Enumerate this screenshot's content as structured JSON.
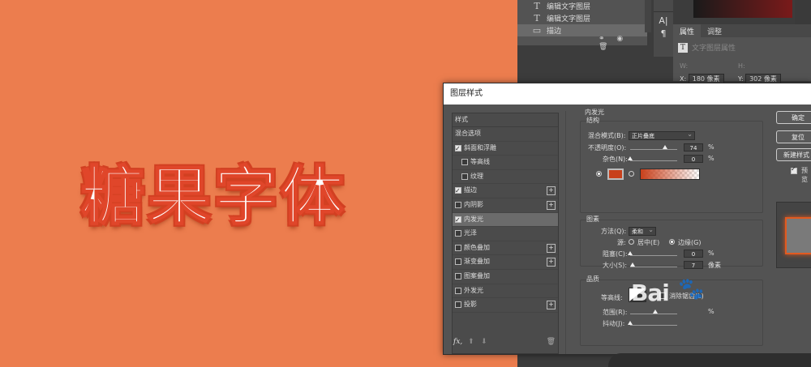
{
  "canvas": {
    "headline": "糖果字体"
  },
  "layers_panel": {
    "rows": [
      {
        "icon": "T",
        "label": "编辑文字图层"
      },
      {
        "icon": "T",
        "label": "编辑文字图层"
      },
      {
        "icon": "▭",
        "label": "描边"
      }
    ],
    "bottom_icons": "⚭ ◉ 🗑"
  },
  "tools": {
    "items": [
      "A|",
      "¶"
    ]
  },
  "properties": {
    "tab_properties": "属性",
    "tab_adjust": "调整",
    "header": "文字图层属性",
    "w_label": "W:",
    "h_label": "H:",
    "x_label": "X:",
    "x_value": "180 像素",
    "y_label": "Y:",
    "y_value": "302 像素"
  },
  "dialog": {
    "title": "图层样式",
    "style_list": {
      "header": "样式",
      "blend_options": "混合选项",
      "items": [
        {
          "label": "斜面和浮雕",
          "checked": true,
          "sub": false,
          "plus": false
        },
        {
          "label": "等高线",
          "checked": false,
          "sub": true,
          "plus": false
        },
        {
          "label": "纹理",
          "checked": false,
          "sub": true,
          "plus": false
        },
        {
          "label": "描边",
          "checked": true,
          "sub": false,
          "plus": true
        },
        {
          "label": "内阴影",
          "checked": false,
          "sub": false,
          "plus": true
        },
        {
          "label": "内发光",
          "checked": true,
          "sub": false,
          "plus": false,
          "selected": true
        },
        {
          "label": "光泽",
          "checked": false,
          "sub": false,
          "plus": false
        },
        {
          "label": "颜色叠加",
          "checked": false,
          "sub": false,
          "plus": true
        },
        {
          "label": "渐变叠加",
          "checked": false,
          "sub": false,
          "plus": true
        },
        {
          "label": "图案叠加",
          "checked": false,
          "sub": false,
          "plus": false
        },
        {
          "label": "外发光",
          "checked": false,
          "sub": false,
          "plus": false
        },
        {
          "label": "投影",
          "checked": false,
          "sub": false,
          "plus": true
        }
      ],
      "fx": "fx,",
      "up": "⬆",
      "down": "⬇",
      "trash": "🗑"
    },
    "inner_glow": {
      "title": "内发光",
      "structure": {
        "title": "结构",
        "blend_mode_label": "混合模式(B):",
        "blend_mode_value": "正片叠底",
        "opacity_label": "不透明度(O):",
        "opacity_value": "74",
        "opacity": 0.74,
        "noise_label": "杂色(N):",
        "noise_value": "0",
        "percent": "%",
        "glow_color": "#c8401b"
      },
      "elements": {
        "title": "图素",
        "method_label": "方法(Q):",
        "method_value": "柔和",
        "source_label": "源:",
        "source_center": "居中(E)",
        "source_edge": "边缘(G)",
        "choke_label": "阻塞(C):",
        "choke_value": "0",
        "size_label": "大小(S):",
        "size_value": "7",
        "size_unit": "像素"
      },
      "quality": {
        "title": "品质",
        "contour_label": "等高线:",
        "antialias_label": "消除锯齿(L)",
        "range_label": "范围(R):",
        "jitter_label": "抖动(J):"
      }
    },
    "buttons": {
      "ok": "确定",
      "reset": "复位",
      "new_style": "新建样式",
      "preview": "预览"
    }
  },
  "watermark": {
    "text": "Bai",
    "paw": "🐾"
  }
}
